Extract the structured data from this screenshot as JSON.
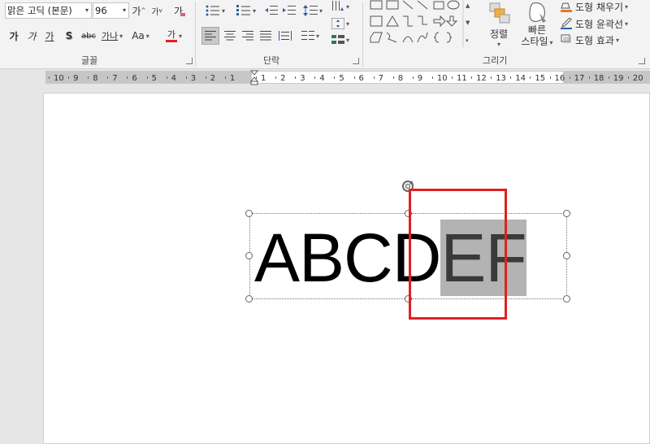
{
  "font_group": {
    "font_name": "맑은 고딕 (본문)",
    "font_size": "96",
    "grow_label": "가",
    "shrink_label": "가",
    "clear_format_label": "가",
    "bold_label": "가",
    "italic_label": "가",
    "underline_label": "가",
    "shadow_label": "S",
    "strike_label": "abc",
    "spacing_label": "가나",
    "case_label": "Aa",
    "color_label": "가",
    "group_label": "글꼴"
  },
  "paragraph_group": {
    "group_label": "단락"
  },
  "drawing_group": {
    "arrange_label": "정렬",
    "quick_styles_line1": "빠른",
    "quick_styles_line2": "스타일",
    "fill_label": "도형 채우기",
    "outline_label": "도형 윤곽선",
    "effects_label": "도형 효과",
    "group_label": "그리기"
  },
  "ruler": {
    "labels": [
      "10",
      "9",
      "8",
      "7",
      "6",
      "5",
      "4",
      "3",
      "2",
      "1",
      "1",
      "2",
      "3",
      "4",
      "5",
      "6",
      "7",
      "8",
      "9",
      "10",
      "11",
      "12",
      "13",
      "14",
      "15",
      "16",
      "17",
      "18",
      "19",
      "20"
    ]
  },
  "slide": {
    "text_normal": "ABCD",
    "text_selected": "EF"
  },
  "colors": {
    "highlight": "#e02020",
    "selection": "#b3b3b3",
    "font_color_bar": "#e02020",
    "fill_bar": "#e87a1e"
  }
}
